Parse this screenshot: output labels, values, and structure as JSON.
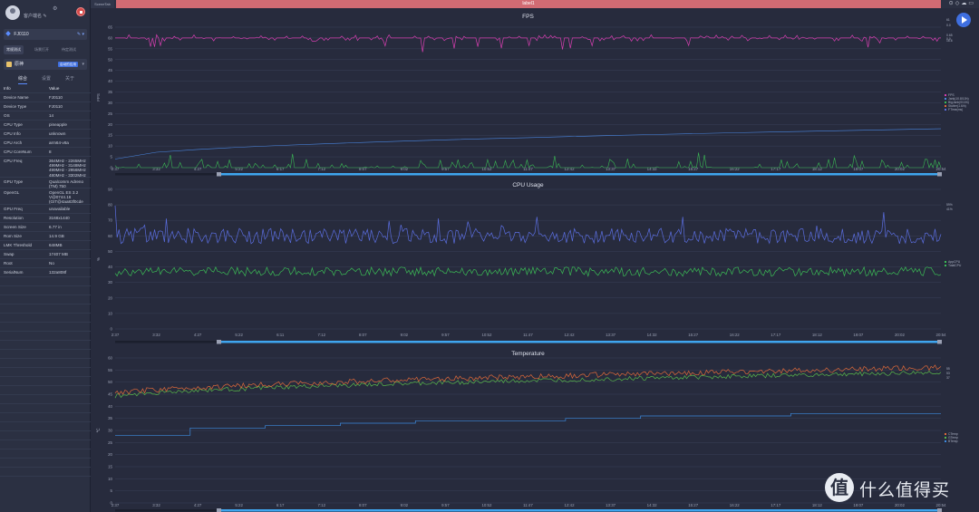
{
  "sidebar": {
    "user_name": "客户端名 ✎",
    "device": "FJ0110",
    "modes": [
      "常规测试",
      "场景打开",
      "待定测试"
    ],
    "app": {
      "name": "原神",
      "badge": "启动的应用"
    },
    "subtabs": [
      "综合",
      "设置",
      "关于"
    ],
    "info_header": {
      "key": "Info",
      "value": "Value"
    },
    "info": [
      {
        "key": "Device Name",
        "value": "FJ0110"
      },
      {
        "key": "Device Type",
        "value": "FJ0110"
      },
      {
        "key": "OS",
        "value": "14"
      },
      {
        "key": "CPU Type",
        "value": "pineapple"
      },
      {
        "key": "CPU Info",
        "value": "unknown"
      },
      {
        "key": "CPU Arch",
        "value": "arm64-v8a"
      },
      {
        "key": "CPU CoreNum",
        "value": "8"
      },
      {
        "key": "CPU Freq",
        "value": "364MHz - 2265MHz\n499MHz - 3148MHz\n499MHz - 2956MHz\n480MHz - 3302MHz"
      },
      {
        "key": "GPU Type",
        "value": "Qualcomm Adreno (TM) 750"
      },
      {
        "key": "OpenGL",
        "value": "OpenGL ES 3.2 V@0744.16 (GIT@4aa83f0cde"
      },
      {
        "key": "GPU Freq",
        "value": "unavailable"
      },
      {
        "key": "Resolution",
        "value": "3168x1440"
      },
      {
        "key": "Screen Size",
        "value": "6.77 in"
      },
      {
        "key": "Rom Size",
        "value": "14.9 GB"
      },
      {
        "key": "LMK Threshold",
        "value": "648MB"
      },
      {
        "key": "Swap",
        "value": "17407 MB"
      },
      {
        "key": "Root",
        "value": "No"
      },
      {
        "key": "SerialNum",
        "value": "132a808f"
      }
    ]
  },
  "topbar": {
    "scene_tab": "SceneTab",
    "label": "label1",
    "icons": [
      "location-icon",
      "pin-icon",
      "cloud-icon",
      "folder-icon"
    ]
  },
  "watermark": {
    "glyph": "值",
    "text": "什么值得买"
  },
  "colors": {
    "bg": "#272b3d",
    "grid": "#394058",
    "fps": "#d63fb0",
    "jank": "#3bbb55",
    "cpu_total": "#5b6ee0",
    "cpu_app": "#3bbb55",
    "temp_cpu": "#e06a3a",
    "temp_gpu": "#58b84a",
    "temp_battery": "#3d8be0",
    "fps_ctx": "#4a86e0",
    "scrollbar": "#3fa6ef"
  },
  "chart_data": [
    {
      "type": "line",
      "title": "FPS",
      "ylabel": "FPS",
      "ylim": [
        0,
        65
      ],
      "yticks": [
        0,
        5,
        10,
        15,
        20,
        25,
        30,
        35,
        40,
        45,
        50,
        55,
        60,
        65
      ],
      "xticks": [
        "2:37",
        "3:32",
        "4:27",
        "5:22",
        "6:17",
        "7:12",
        "8:07",
        "9:02",
        "9:57",
        "10:52",
        "11:47",
        "12:42",
        "13:37",
        "14:32",
        "15:27",
        "16:22",
        "17:17",
        "18:12",
        "19:07",
        "20:02",
        "20:54"
      ],
      "legend": [
        "FPS",
        "Jank(10.8/10h)",
        "BigJank(0/10h)",
        "Stutter(1.6/h)",
        "FTime(ms)"
      ],
      "end_labels": [
        "61",
        "0.0",
        "0.65",
        "0.0",
        "16.6"
      ],
      "series": [
        {
          "name": "FPS",
          "start": 60,
          "end": 60
        },
        {
          "name": "Jank",
          "start": 0,
          "end": 0
        },
        {
          "name": "FTime(ms)",
          "start": 4,
          "end": 18
        }
      ]
    },
    {
      "type": "line",
      "title": "CPU Usage",
      "ylabel": "%",
      "ylim": [
        0,
        90
      ],
      "yticks": [
        0,
        10,
        20,
        30,
        40,
        50,
        60,
        70,
        80,
        90
      ],
      "xticks": [
        "2:37",
        "3:32",
        "4:27",
        "5:22",
        "6:11",
        "7:12",
        "8:07",
        "9:02",
        "9:57",
        "10:52",
        "11:47",
        "12:42",
        "13:37",
        "14:32",
        "15:27",
        "16:22",
        "17:17",
        "18:12",
        "19:07",
        "20:02",
        "20:54"
      ],
      "legend": [
        "AppCPU",
        "TotalCPU"
      ],
      "end_labels": [
        "59%",
        "41%"
      ],
      "series": [
        {
          "name": "TotalCPU",
          "mean": 60
        },
        {
          "name": "AppCPU",
          "mean": 38
        }
      ]
    },
    {
      "type": "line",
      "title": "Temperature",
      "ylabel": "℃",
      "ylim": [
        0,
        60
      ],
      "yticks": [
        0,
        5,
        10,
        15,
        20,
        25,
        30,
        35,
        40,
        45,
        50,
        55,
        60
      ],
      "xticks": [
        "2:37",
        "3:32",
        "4:27",
        "5:22",
        "6:17",
        "7:12",
        "8:07",
        "9:02",
        "9:57",
        "10:52",
        "11:47",
        "12:42",
        "13:37",
        "14:32",
        "15:27",
        "16:22",
        "17:17",
        "18:12",
        "19:07",
        "20:02",
        "20:54"
      ],
      "legend": [
        "CTemp",
        "GTemp",
        "BTemp"
      ],
      "end_labels": [
        "55",
        "53",
        "37"
      ],
      "series": [
        {
          "name": "CTemp",
          "start": 45,
          "end": 56
        },
        {
          "name": "GTemp",
          "start": 44,
          "end": 54
        },
        {
          "name": "BTemp",
          "start": 28,
          "end": 37
        }
      ]
    }
  ]
}
